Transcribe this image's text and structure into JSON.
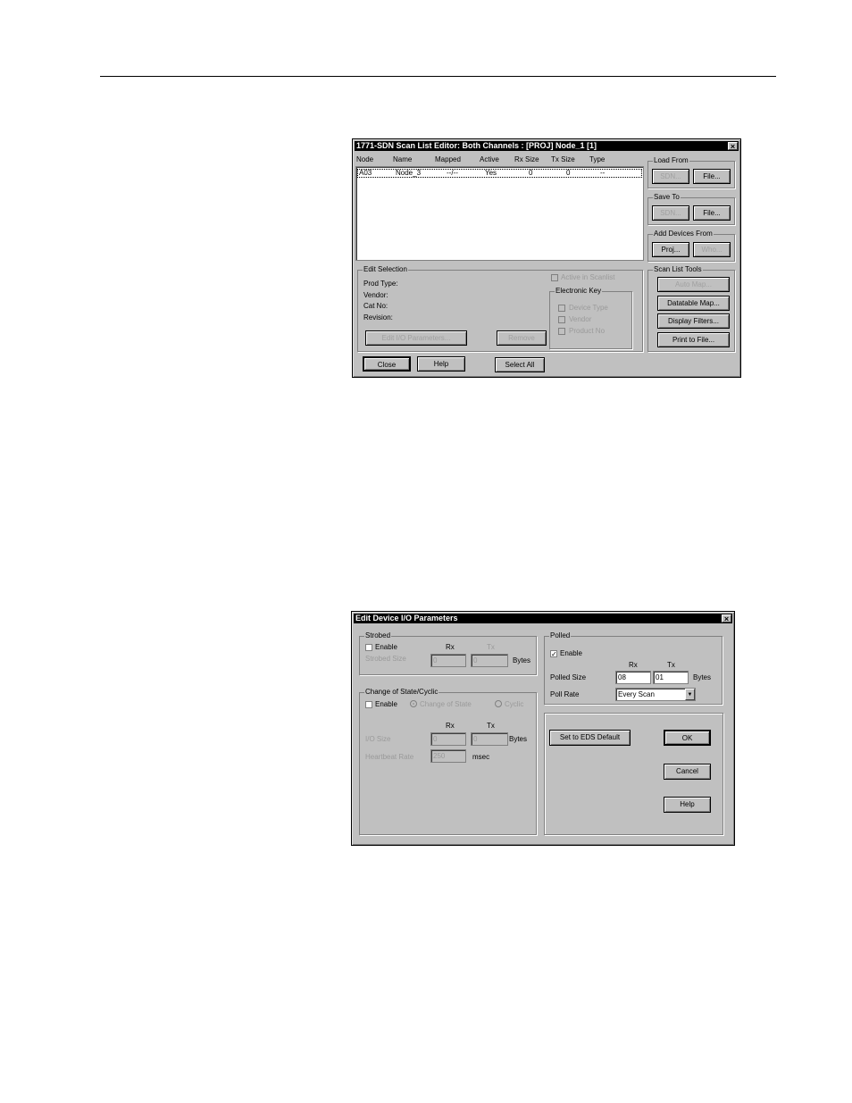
{
  "scan_list_editor": {
    "title": "1771-SDN Scan List Editor: Both Channels : [PROJ] Node_1 [1]",
    "columns": [
      "Node",
      "Name",
      "Mapped",
      "Active",
      "Rx Size",
      "Tx Size",
      "Type"
    ],
    "rows": [
      {
        "node": "A03",
        "name": "Node_3",
        "mapped": "--/--",
        "active": "Yes",
        "rx": "0",
        "tx": "0",
        "type": "--"
      }
    ],
    "load_from": {
      "label": "Load From",
      "sdn": "SDN...",
      "file": "File..."
    },
    "save_to": {
      "label": "Save To",
      "sdn": "SDN...",
      "file": "File..."
    },
    "add_devices_from": {
      "label": "Add Devices From",
      "proj": "Proj...",
      "who": "Who..."
    },
    "scan_list_tools": {
      "label": "Scan List Tools",
      "auto_map": "Auto Map...",
      "datatable_map": "Datatable Map...",
      "display_filters": "Display Filters...",
      "print_to_file": "Print to File..."
    },
    "edit_selection": {
      "label": "Edit Selection",
      "prod_type": "Prod Type:",
      "vendor": "Vendor:",
      "cat_no": "Cat No:",
      "revision": "Revision:",
      "active_in_scanlist": "Active in Scanlist",
      "electronic_key": "Electronic Key",
      "device_type": "Device Type",
      "vendor_chk": "Vendor",
      "product_no": "Product No",
      "edit_io": "Edit I/O Parameters...",
      "remove": "Remove"
    },
    "bottom": {
      "close": "Close",
      "help": "Help",
      "select_all": "Select All"
    }
  },
  "edit_device_io": {
    "title": "Edit Device I/O Parameters",
    "strobed": {
      "label": "Strobed",
      "enable": "Enable",
      "rx": "Rx",
      "tx": "Tx",
      "size_label": "Strobed Size",
      "rx_value": "0",
      "tx_value": "0",
      "bytes": "Bytes"
    },
    "cos": {
      "label": "Change of State/Cyclic",
      "enable": "Enable",
      "change_of_state": "Change of State",
      "cyclic": "Cyclic",
      "rx": "Rx",
      "tx": "Tx",
      "io_size": "I/O Size",
      "rx_value": "0",
      "tx_value": "0",
      "bytes": "Bytes",
      "heartbeat": "Heartbeat Rate",
      "heartbeat_value": "250",
      "msec": "msec"
    },
    "polled": {
      "label": "Polled",
      "enable": "Enable",
      "enable_mark": "✓",
      "rx": "Rx",
      "tx": "Tx",
      "size_label": "Polled Size",
      "rx_value": "08",
      "tx_value": "01",
      "bytes": "Bytes",
      "poll_rate_label": "Poll Rate",
      "poll_rate_value": "Every Scan"
    },
    "set_eds_default": "Set to EDS Default",
    "ok": "OK",
    "cancel": "Cancel",
    "help": "Help"
  }
}
